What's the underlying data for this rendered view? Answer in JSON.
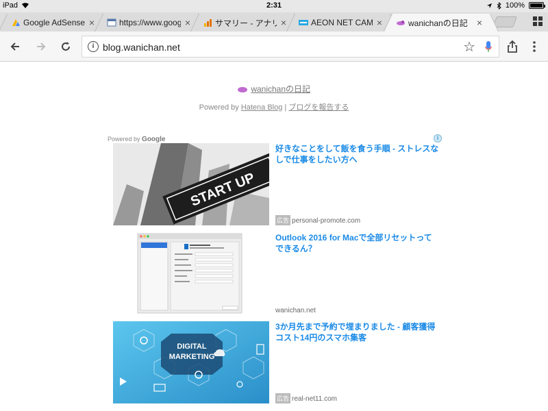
{
  "status_bar": {
    "device": "iPad",
    "time": "2:31",
    "battery_text": "100%",
    "battery_level": 1.0
  },
  "tabs": [
    {
      "title": "Google AdSense",
      "favicon": "adsense-icon",
      "active": false
    },
    {
      "title": "https://www.google",
      "favicon": "page-icon",
      "active": false
    },
    {
      "title": "サマリー - アナリ",
      "favicon": "analytics-icon",
      "active": false
    },
    {
      "title": "AEON NET CAMPU",
      "favicon": "aeon-icon",
      "active": false
    },
    {
      "title": "wanichanの日記",
      "favicon": "hatena-icon",
      "active": true
    }
  ],
  "toolbar": {
    "url": "blog.wanichan.net",
    "icons": [
      "back-icon",
      "forward-icon",
      "reload-icon",
      "star-icon",
      "mic-icon",
      "share-icon",
      "menu-icon"
    ]
  },
  "page": {
    "blog_title": "wanichanの日記",
    "powered_prefix": "Powered by ",
    "powered_link": "Hatena Blog",
    "separator": " | ",
    "report_link": "ブログを報告する"
  },
  "ads": {
    "powered_by": "Powered by",
    "powered_brand": "Google",
    "info_icon": "i",
    "items": [
      {
        "headline": "好きなことをして飯を食う手順 - ストレスなしで仕事をしたい方へ",
        "badge": "広告",
        "source": "personal-promote.com",
        "image": "startup-sign-image",
        "image_text": "START UP"
      },
      {
        "headline": "Outlook 2016 for Macで全部リセットってできるん？",
        "badge": "",
        "source": "wanichan.net",
        "image": "outlook-screenshot-image",
        "image_text": ""
      },
      {
        "headline": "3か月先まで予約で埋まりました - 顧客獲得コスト14円のスマホ集客",
        "badge": "広告",
        "source": "real-net11.com",
        "image": "digital-marketing-image",
        "image_text": "DIGITAL MARKETING"
      }
    ]
  }
}
